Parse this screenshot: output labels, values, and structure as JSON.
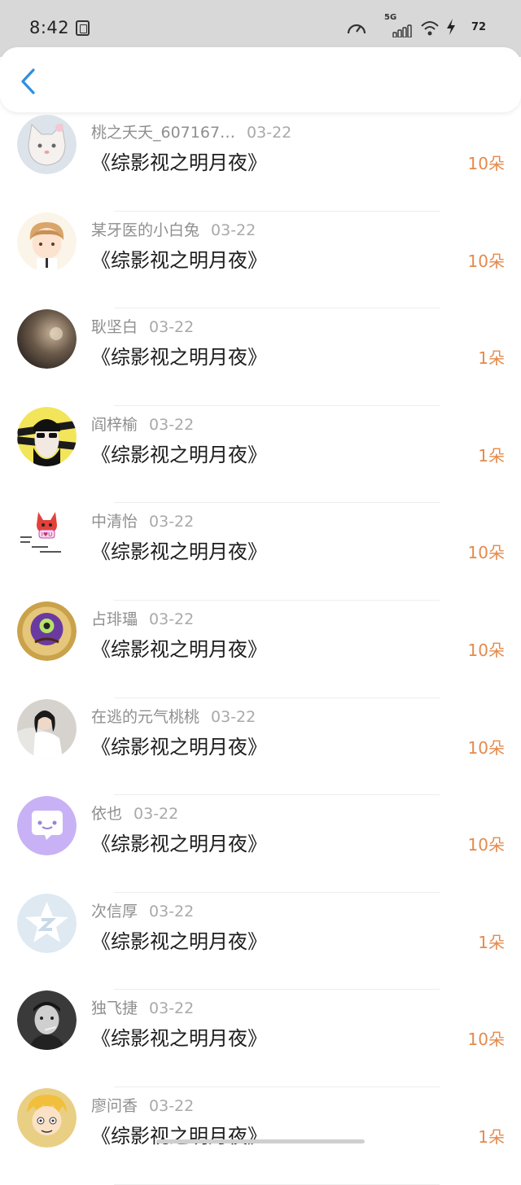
{
  "status": {
    "time": "8:42",
    "network": "5G",
    "battery": "72"
  },
  "records": [
    {
      "name": "桃之夭夭_607167…",
      "date": "03-22",
      "title": "《综影视之明月夜》",
      "amount": "10朵",
      "avatar": "cat-avatar"
    },
    {
      "name": "某牙医的小白兔",
      "date": "03-22",
      "title": "《综影视之明月夜》",
      "amount": "10朵",
      "avatar": "cartoon-boy-avatar"
    },
    {
      "name": "耿坚白",
      "date": "03-22",
      "title": "《综影视之明月夜》",
      "amount": "1朵",
      "avatar": "blurry-light-avatar"
    },
    {
      "name": "阎梓榆",
      "date": "03-22",
      "title": "《综影视之明月夜》",
      "amount": "1朵",
      "avatar": "caution-tape-avatar"
    },
    {
      "name": "中清怡",
      "date": "03-22",
      "title": "《综影视之明月夜》",
      "amount": "10朵",
      "avatar": "fox-i-love-you-avatar"
    },
    {
      "name": "占琲瓃",
      "date": "03-22",
      "title": "《综影视之明月夜》",
      "amount": "10朵",
      "avatar": "gold-badge-avatar"
    },
    {
      "name": "在逃的元气桃桃",
      "date": "03-22",
      "title": "《综影视之明月夜》",
      "amount": "10朵",
      "avatar": "woman-white-dress-avatar"
    },
    {
      "name": "依也",
      "date": "03-22",
      "title": "《综影视之明月夜》",
      "amount": "10朵",
      "avatar": "chat-bubble-avatar"
    },
    {
      "name": "次信厚",
      "date": "03-22",
      "title": "《综影视之明月夜》",
      "amount": "1朵",
      "avatar": "default-star-avatar"
    },
    {
      "name": "独飞捷",
      "date": "03-22",
      "title": "《综影视之明月夜》",
      "amount": "10朵",
      "avatar": "man-bw-avatar"
    },
    {
      "name": "廖问香",
      "date": "03-22",
      "title": "《综影视之明月夜》",
      "amount": "1朵",
      "avatar": "anime-boy-avatar"
    }
  ],
  "colors": {
    "accent": "#e48a4c",
    "back": "#2f8fe0",
    "meta": "#8f8f8f",
    "title": "#1c1c1c"
  }
}
